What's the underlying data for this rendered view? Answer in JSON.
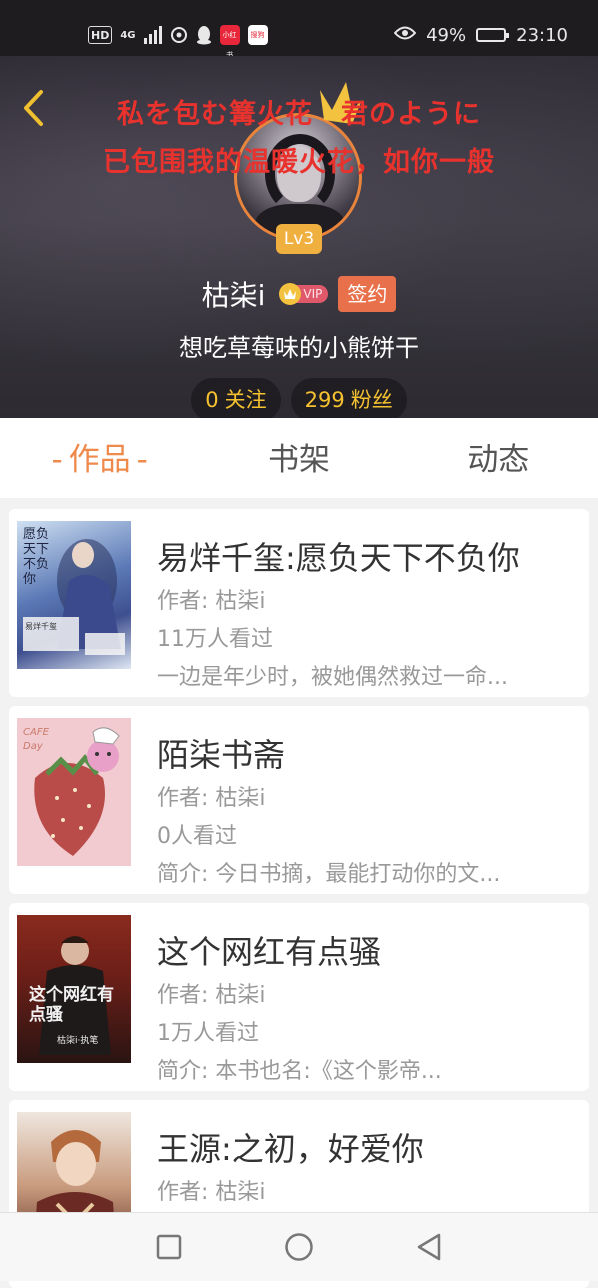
{
  "status_bar": {
    "network_hd": "HD",
    "network_type": "4G",
    "battery_percent": "49%",
    "battery_level": 0.49,
    "time": "23:10",
    "app_icons": [
      "netease-music-icon",
      "qq-icon",
      "xiaohongshu-icon",
      "sogou-icon"
    ],
    "xiaohongshu_label": "小红书",
    "sogou_label": "搜狗"
  },
  "profile": {
    "signature_line_1": "私を包む篝火花　君のように",
    "signature_line_2": "已包围我的温暖火花，如你一般",
    "level": "Lv3",
    "nickname": "枯柒i",
    "vip_label": "VIP",
    "signed_label": "签约",
    "bio": "想吃草莓味的小熊饼干",
    "following_count": "0",
    "following_label": "关注",
    "followers_count": "299",
    "followers_label": "粉丝"
  },
  "tabs": [
    {
      "label": "作品",
      "active": true
    },
    {
      "label": "书架",
      "active": false
    },
    {
      "label": "动态",
      "active": false
    }
  ],
  "works": [
    {
      "title": "易烊千玺:愿负天下不负你",
      "author": "作者: 枯柒i",
      "views": "11万人看过",
      "desc": "一边是年少时，被她偶然救过一命...",
      "cover_text": "愿负天下 不负你",
      "cover_caption": "易烊千玺"
    },
    {
      "title": "陌柒书斋",
      "author": "作者: 枯柒i",
      "views": "0人看过",
      "desc": "简介: 今日书摘，最能打动你的文...",
      "cover_text": "CAFE Day"
    },
    {
      "title": "这个网红有点骚",
      "author": "作者: 枯柒i",
      "views": "1万人看过",
      "desc": "简介: 本书也名:《这个影帝...",
      "cover_text": "这个网红有点骚",
      "cover_caption": "枯柒i·执笔"
    },
    {
      "title": "王源:之初，好爱你",
      "author": "作者: 枯柒i",
      "views": "",
      "desc": ""
    }
  ],
  "nav_bar": {
    "buttons": [
      "recent-apps-icon",
      "home-icon",
      "back-icon"
    ]
  },
  "colors": {
    "accent_orange": "#ee8a4c",
    "signature_red": "#e8322d",
    "stat_yellow": "#f6c230",
    "level_badge": "#f0b040",
    "signed_badge": "#e8704a"
  }
}
